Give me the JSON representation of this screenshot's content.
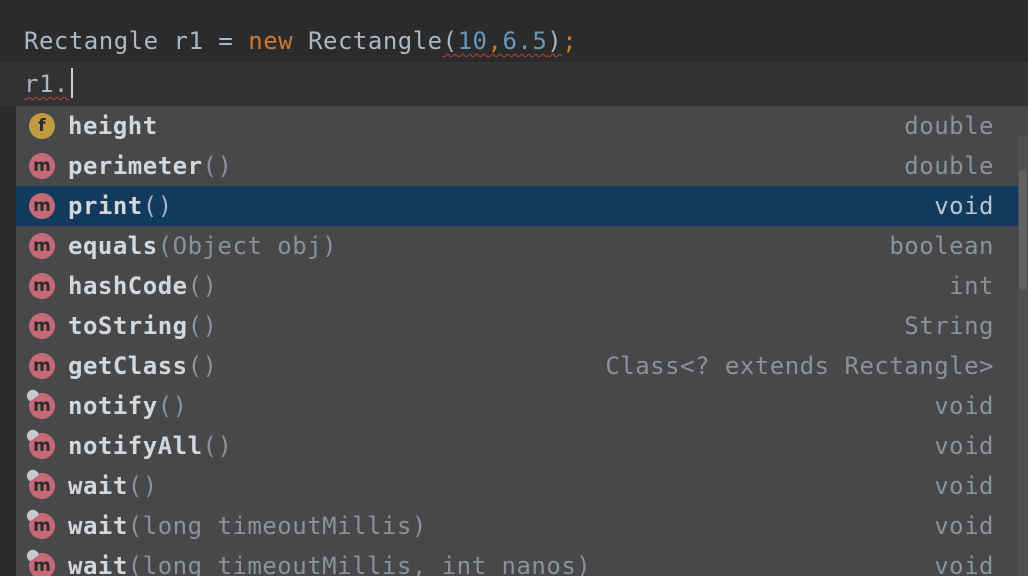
{
  "editor": {
    "line1": {
      "type": "Rectangle",
      "var": "r1",
      "eq": "=",
      "kw_new": "new",
      "ctor": "Rectangle",
      "open": "(",
      "arg1": "10",
      "comma": ",",
      "arg2": "6.5",
      "close": ")",
      "semi": ";"
    },
    "line2": {
      "text": "r1."
    }
  },
  "completion": {
    "items": [
      {
        "kind": "f",
        "name": "height",
        "sig": "",
        "type": "double"
      },
      {
        "kind": "m",
        "name": "perimeter",
        "sig": "()",
        "type": "double"
      },
      {
        "kind": "m",
        "name": "print",
        "sig": "()",
        "type": "void",
        "selected": true
      },
      {
        "kind": "m",
        "name": "equals",
        "sig": "(Object obj)",
        "type": "boolean"
      },
      {
        "kind": "m",
        "name": "hashCode",
        "sig": "()",
        "type": "int"
      },
      {
        "kind": "m",
        "name": "toString",
        "sig": "()",
        "type": "String"
      },
      {
        "kind": "m",
        "name": "getClass",
        "sig": "()",
        "type": "Class<? extends Rectangle>"
      },
      {
        "kind": "m",
        "name": "notify",
        "sig": "()",
        "type": "void",
        "inherited": true
      },
      {
        "kind": "m",
        "name": "notifyAll",
        "sig": "()",
        "type": "void",
        "inherited": true
      },
      {
        "kind": "m",
        "name": "wait",
        "sig": "()",
        "type": "void",
        "inherited": true
      },
      {
        "kind": "m",
        "name": "wait",
        "sig": "(long timeoutMillis)",
        "type": "void",
        "inherited": true
      },
      {
        "kind": "m",
        "name": "wait",
        "sig": "(long timeoutMillis, int nanos)",
        "type": "void",
        "inherited": true
      }
    ]
  },
  "colors": {
    "background": "#2b2b2b",
    "popup": "#46484a",
    "selection": "#113a5c",
    "keyword": "#cc7832",
    "number": "#6897bb",
    "field_badge": "#c29a3f",
    "method_badge": "#c46a77"
  }
}
